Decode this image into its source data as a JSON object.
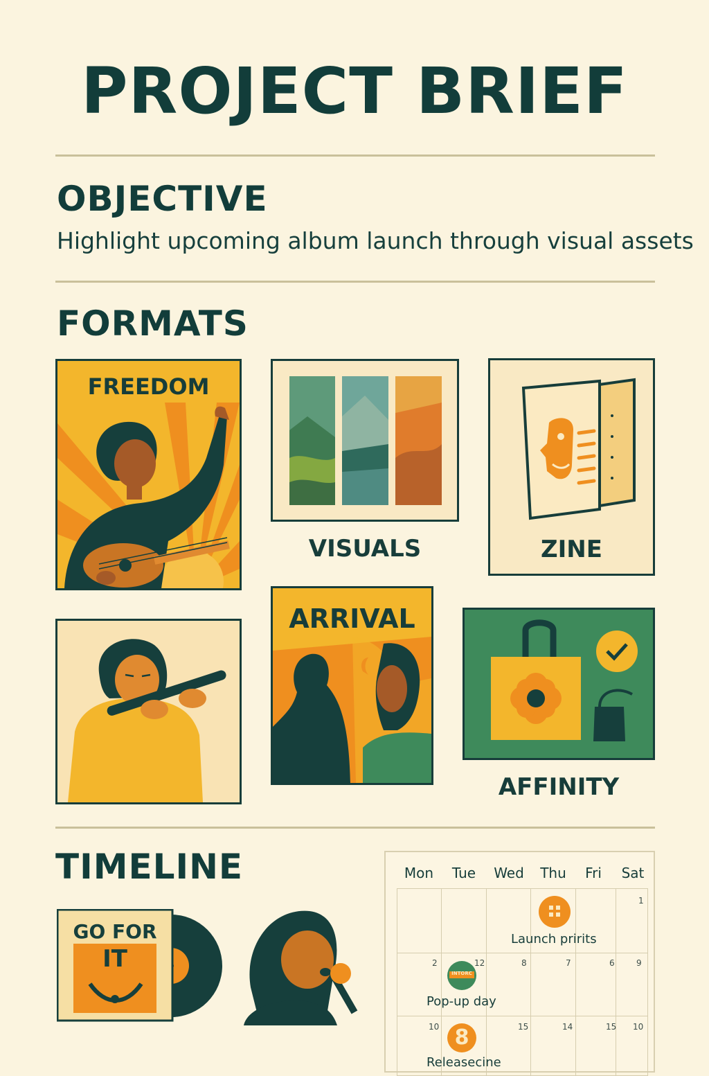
{
  "title": "PROJECT BRIEF",
  "objective": {
    "heading": "OBJECTIVE",
    "text": "Highlight upcoming album launch through visual assets"
  },
  "formats": {
    "heading": "FORMATS",
    "items": [
      {
        "label": "FREEDOM"
      },
      {
        "label": "VISUALS"
      },
      {
        "label": "ZINE"
      },
      {
        "label": "ARRIVAL"
      },
      {
        "label": "AFFINITY"
      }
    ]
  },
  "timeline": {
    "heading": "TIMELINE",
    "album_text_1": "GO FOR",
    "album_text_2": "IT",
    "calendar": {
      "days": [
        "Mon",
        "Tue",
        "Wed",
        "Thu",
        "Fri",
        "Sat"
      ],
      "numbers": [
        "1",
        "2",
        "12",
        "8",
        "7",
        "6",
        "9",
        "10",
        "15",
        "14",
        "15",
        "10"
      ],
      "events": [
        {
          "label": "Launch pririts",
          "icon": "grid-icon"
        },
        {
          "label": "Pop-up day",
          "icon": "badge-icon",
          "badge_text": "INTORC"
        },
        {
          "label": "Releasecine",
          "icon": "number-icon",
          "badge_text": "8"
        }
      ]
    }
  },
  "colors": {
    "background": "#fbf4df",
    "dark_green": "#123d3a",
    "orange": "#ef8f1f",
    "yellow": "#f2b52b",
    "green": "#3e8a5b"
  }
}
